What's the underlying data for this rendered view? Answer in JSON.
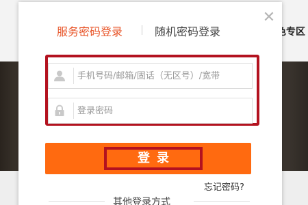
{
  "background": {
    "right_link": "色专区"
  },
  "modal": {
    "close_glyph": "✕",
    "tabs": [
      {
        "label": "服务密码登录",
        "active": true
      },
      {
        "label": "随机密码登录",
        "active": false
      }
    ],
    "phone_field": {
      "placeholder": "手机号码/邮箱/固话（无区号）/宽带",
      "value": ""
    },
    "password_field": {
      "placeholder": "登录密码",
      "value": ""
    },
    "login_button_label": "登录",
    "forgot_password": "忘记密码?",
    "other_login_label": "其他登录方式"
  },
  "colors": {
    "accent": "#e8562a",
    "button": "#ff6a10",
    "highlight_frame": "#b3121f"
  }
}
